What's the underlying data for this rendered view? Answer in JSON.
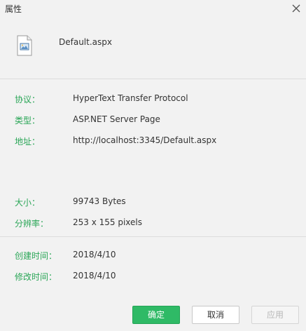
{
  "window": {
    "title": "属性"
  },
  "file": {
    "name": "Default.aspx",
    "icon": "document-image-icon"
  },
  "properties": [
    {
      "label": "协议：",
      "value": "HyperText Transfer Protocol"
    },
    {
      "label": "类型：",
      "value": "ASP.NET Server Page"
    },
    {
      "label": "地址：",
      "value": "http://localhost:3345/Default.aspx"
    },
    {
      "label": "大小：",
      "value": "99743 Bytes"
    },
    {
      "label": "分辨率：",
      "value": "253 x 155 pixels"
    },
    {
      "label": "创建时间：",
      "value": "2018/4/10"
    },
    {
      "label": "修改时间：",
      "value": "2018/4/10"
    }
  ],
  "buttons": {
    "ok": "确定",
    "cancel": "取消",
    "apply": "应用"
  },
  "colors": {
    "accent": "#2aa657",
    "ok_button": "#2fba66",
    "background": "#f2f2f2"
  }
}
